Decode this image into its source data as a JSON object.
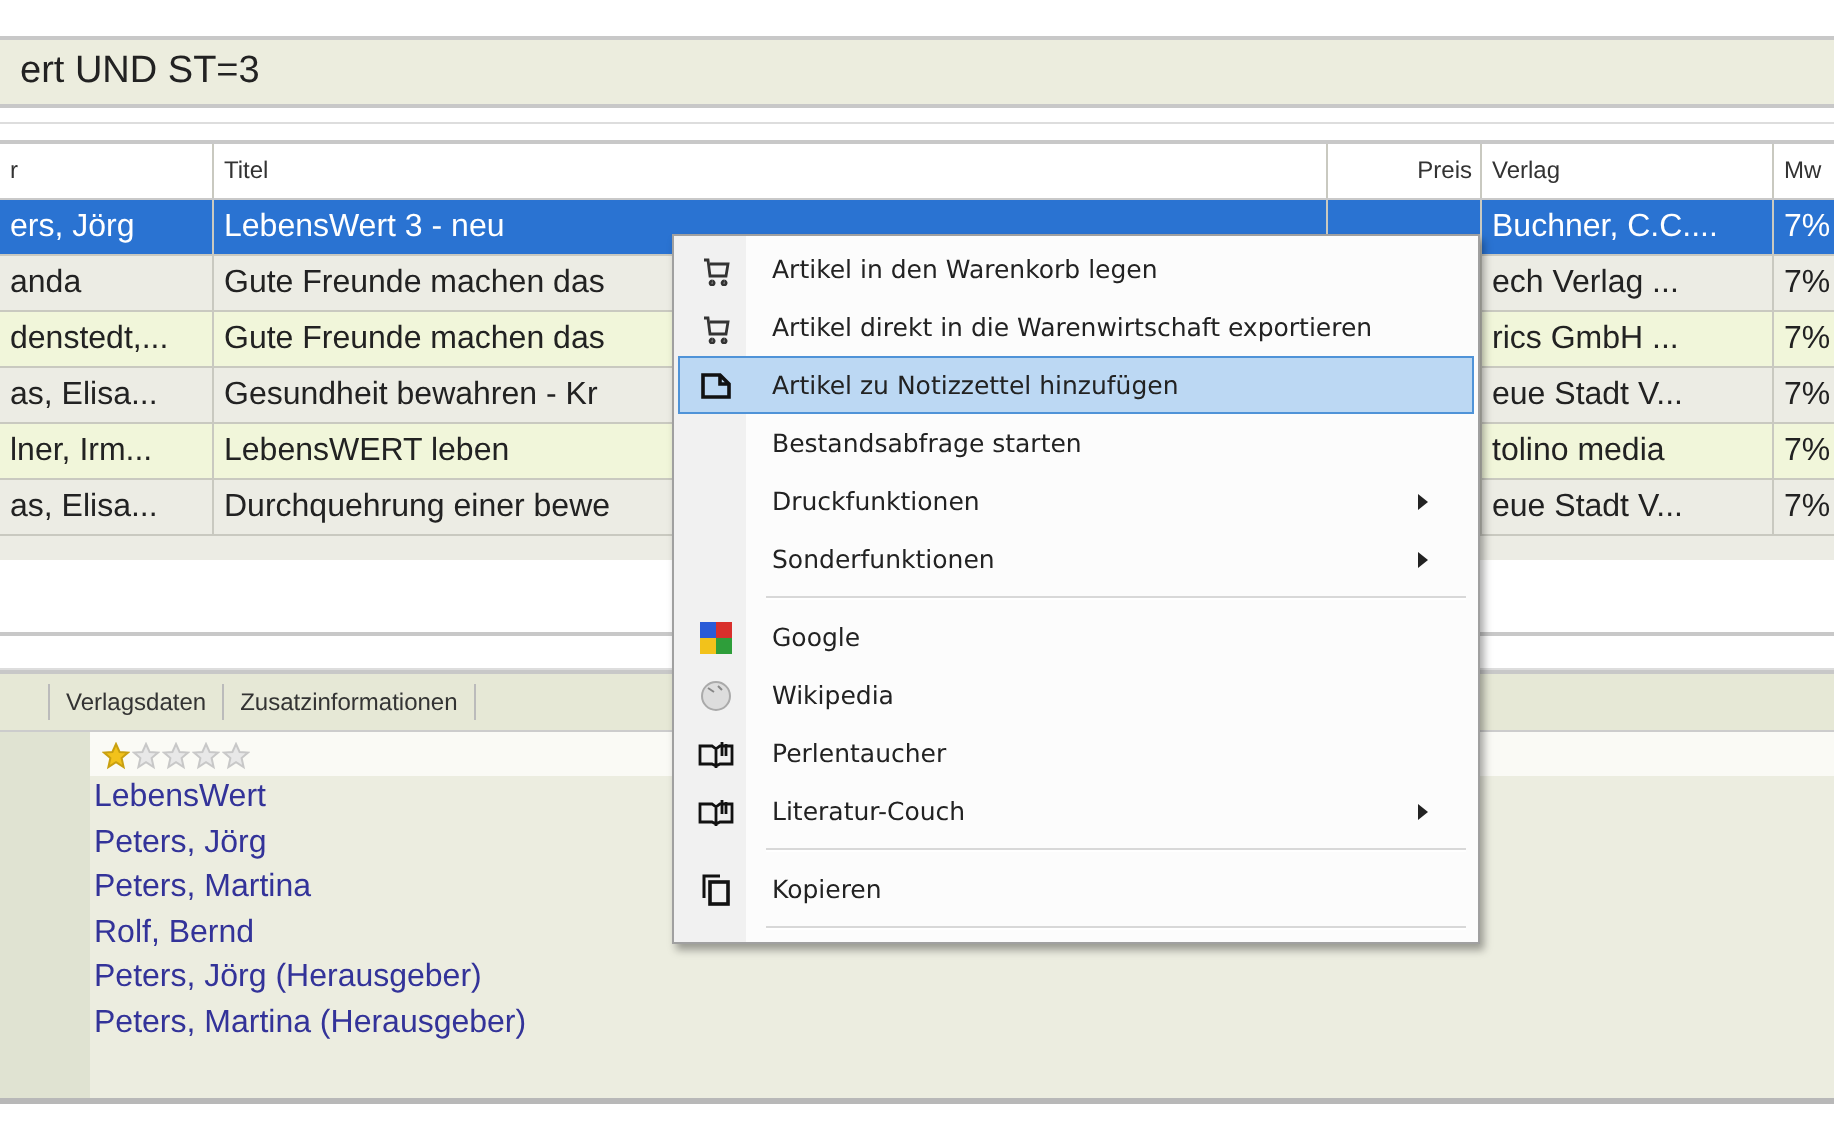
{
  "query_bar": {
    "text": "ert UND ST=3"
  },
  "table": {
    "columns": [
      "r",
      "Titel",
      "Preis",
      "Verlag",
      "Mw"
    ],
    "rows": [
      {
        "cells": [
          "ers, Jörg",
          "LebensWert 3 - neu",
          "",
          "Buchner, C.C....",
          "7%"
        ],
        "selected": true
      },
      {
        "cells": [
          "anda",
          "Gute Freunde machen das",
          "",
          "ech Verlag ...",
          "7%"
        ],
        "selected": false
      },
      {
        "cells": [
          "denstedt,...",
          "Gute Freunde machen das",
          "",
          "rics GmbH ...",
          "7%"
        ],
        "selected": false
      },
      {
        "cells": [
          "as, Elisa...",
          "Gesundheit bewahren - Kr",
          "",
          "eue Stadt V...",
          "7%"
        ],
        "selected": false
      },
      {
        "cells": [
          "lner, Irm...",
          "LebensWERT leben",
          "",
          "tolino media",
          "7%"
        ],
        "selected": false
      },
      {
        "cells": [
          "as, Elisa...",
          "Durchquehrung einer bewe",
          "",
          "eue Stadt V...",
          "7%"
        ],
        "selected": false
      }
    ]
  },
  "detail_tabs": [
    "Verlagsdaten",
    "Zusatzinformationen"
  ],
  "details": {
    "stars": 1,
    "lines": [
      "LebensWert",
      "Peters, Jörg",
      "Peters, Martina",
      "Rolf, Bernd",
      "Peters, Jörg (Herausgeber)",
      "Peters, Martina (Herausgeber)"
    ]
  },
  "context_menu": {
    "items": [
      {
        "kind": "cart",
        "label": "Artikel in den Warenkorb legen",
        "selected": false,
        "submenu": false
      },
      {
        "kind": "cart",
        "label": "Artikel direkt in die Warenwirtschaft exportieren",
        "selected": false,
        "submenu": false
      },
      {
        "kind": "note",
        "label": "Artikel zu Notizzettel hinzufügen",
        "selected": true,
        "submenu": false
      },
      {
        "kind": "plain",
        "label": "Bestandsabfrage starten",
        "selected": false,
        "submenu": false
      },
      {
        "kind": "plain",
        "label": "Druckfunktionen",
        "selected": false,
        "submenu": true
      },
      {
        "kind": "plain",
        "label": "Sonderfunktionen",
        "selected": false,
        "submenu": true
      },
      {
        "kind": "separator"
      },
      {
        "kind": "google",
        "label": "Google",
        "selected": false,
        "submenu": false
      },
      {
        "kind": "globe",
        "label": "Wikipedia",
        "selected": false,
        "submenu": false
      },
      {
        "kind": "book",
        "label": "Perlentaucher",
        "selected": false,
        "submenu": false
      },
      {
        "kind": "book",
        "label": "Literatur-Couch",
        "selected": false,
        "submenu": true
      },
      {
        "kind": "separator"
      },
      {
        "kind": "copy",
        "label": "Kopieren",
        "selected": false,
        "submenu": false
      },
      {
        "kind": "separator"
      }
    ]
  }
}
